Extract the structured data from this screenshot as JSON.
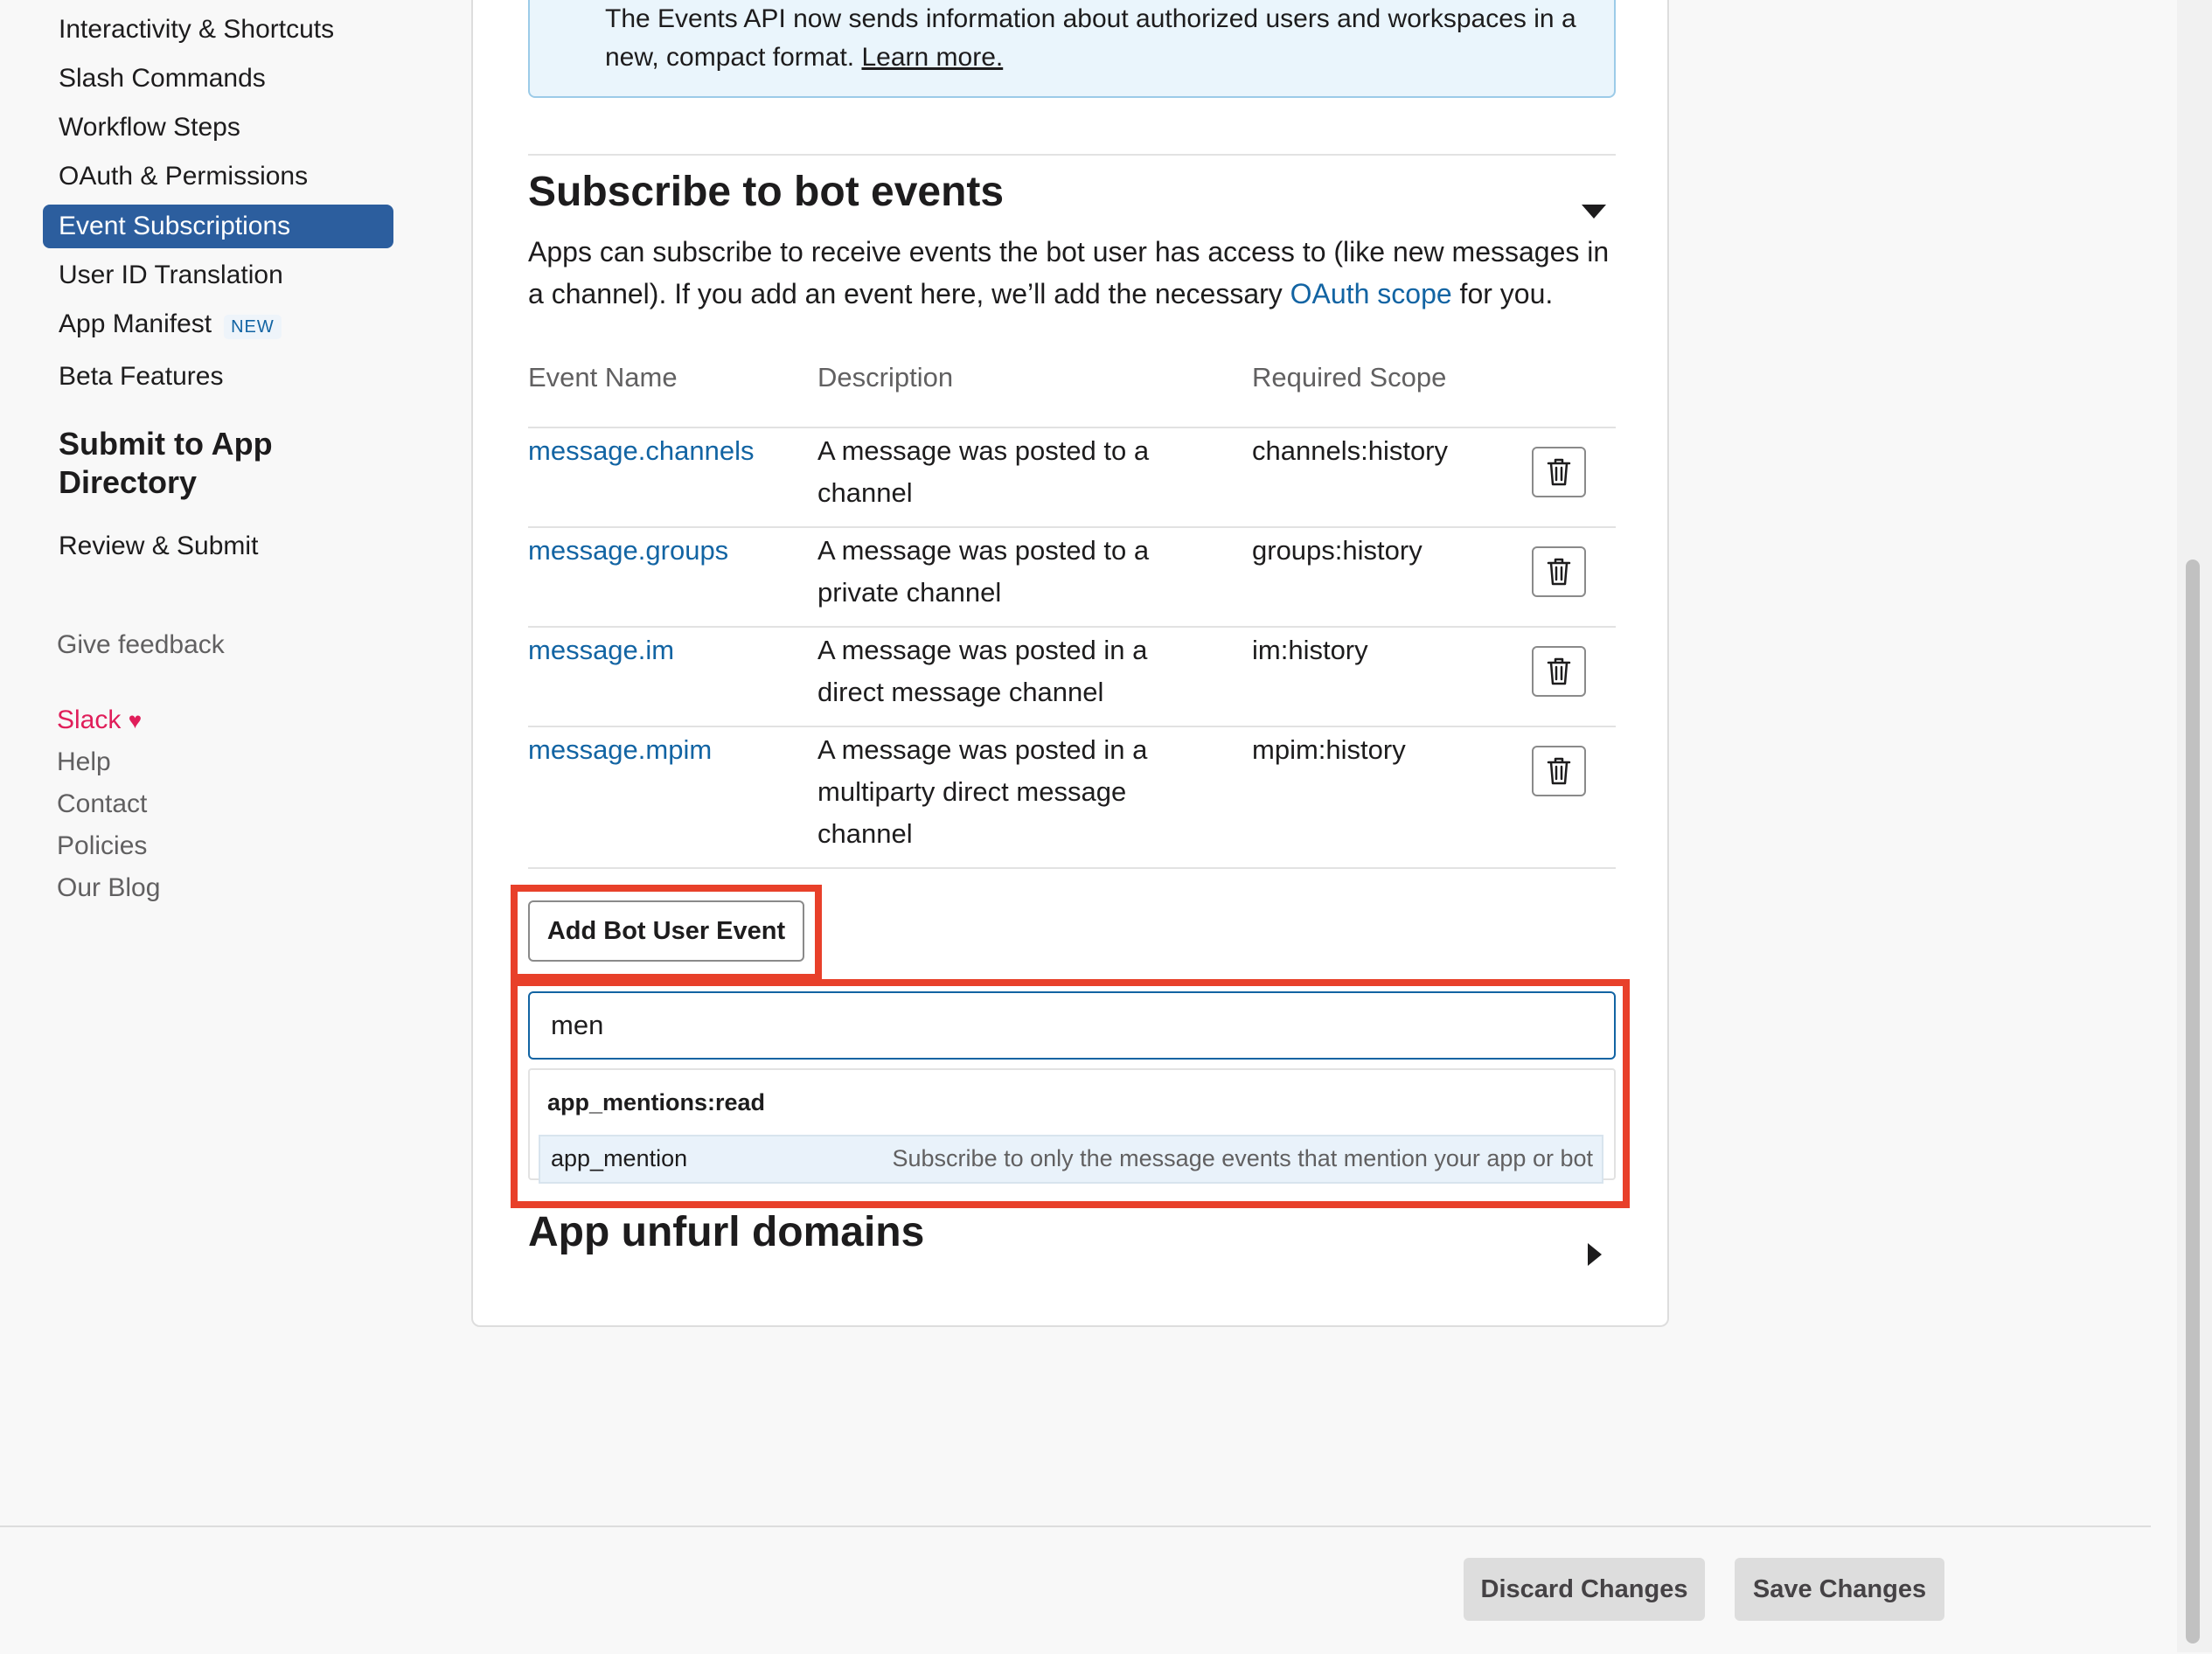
{
  "sidebar": {
    "items": [
      {
        "label": "Interactivity & Shortcuts"
      },
      {
        "label": "Slash Commands"
      },
      {
        "label": "Workflow Steps"
      },
      {
        "label": "OAuth & Permissions"
      },
      {
        "label": "Event Subscriptions",
        "active": true
      },
      {
        "label": "User ID Translation"
      },
      {
        "label": "App Manifest",
        "badge": "NEW"
      },
      {
        "label": "Beta Features"
      }
    ],
    "submit_heading": "Submit to App Directory",
    "review_label": "Review & Submit",
    "feedback_label": "Give feedback",
    "footer_links": {
      "slack": "Slack",
      "help": "Help",
      "contact": "Contact",
      "policies": "Policies",
      "blog": "Our Blog"
    }
  },
  "notice": {
    "text": "The Events API now sends information about authorized users and workspaces in a new, compact format.",
    "link": "Learn more."
  },
  "bot_events": {
    "title": "Subscribe to bot events",
    "description_before": "Apps can subscribe to receive events the bot user has access to (like new messages in a channel). If you add an event here, we’ll add the necessary",
    "description_link": "OAuth scope",
    "description_after": "for you.",
    "columns": [
      "Event Name",
      "Description",
      "Required Scope"
    ],
    "rows": [
      {
        "name": "message.channels",
        "description": "A message was posted to a channel",
        "scope": "channels:history"
      },
      {
        "name": "message.groups",
        "description": "A message was posted to a private channel",
        "scope": "groups:history"
      },
      {
        "name": "message.im",
        "description": "A message was posted in a direct message channel",
        "scope": "im:history"
      },
      {
        "name": "message.mpim",
        "description": "A message was posted in a multiparty direct message channel",
        "scope": "mpim:history"
      }
    ],
    "add_button": "Add Bot User Event",
    "search_value": "men",
    "dropdown": {
      "group": "app_mentions:read",
      "option_name": "app_mention",
      "option_desc": "Subscribe to only the message events that mention your app or bot"
    }
  },
  "unfurl": {
    "title": "App unfurl domains"
  },
  "footer": {
    "discard": "Discard Changes",
    "save": "Save Changes"
  },
  "colors": {
    "accent": "#1264a3",
    "active_nav": "#2c5e9e",
    "highlight": "#e8402a",
    "slack_heart": "#e01e5a"
  }
}
